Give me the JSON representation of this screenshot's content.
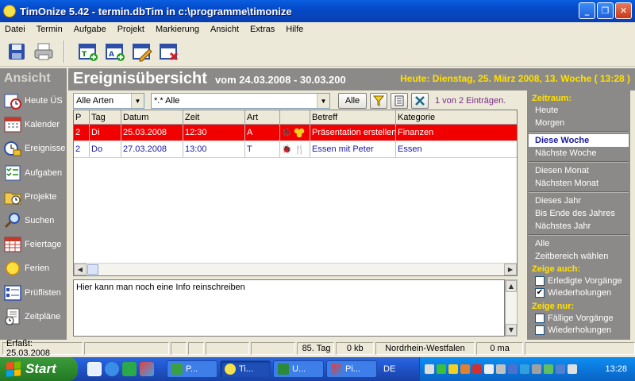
{
  "window": {
    "title": "TimOnize 5.42 - termin.dbTim in c:\\programme\\timonize"
  },
  "menu": [
    "Datei",
    "Termin",
    "Aufgabe",
    "Projekt",
    "Markierung",
    "Ansicht",
    "Extras",
    "Hilfe"
  ],
  "toolbar": {
    "icons": [
      "save-icon",
      "print-icon",
      "new-appointment-icon",
      "new-task-icon",
      "edit-icon",
      "delete-icon"
    ]
  },
  "nav": {
    "header": "Ansicht",
    "items": [
      {
        "label": "Heute ÜS",
        "icon": "clock-icon"
      },
      {
        "label": "Kalender",
        "icon": "calendar-icon"
      },
      {
        "label": "Ereignisse",
        "icon": "events-icon"
      },
      {
        "label": "Aufgaben",
        "icon": "tasks-icon"
      },
      {
        "label": "Projekte",
        "icon": "projects-icon"
      },
      {
        "label": "Suchen",
        "icon": "search-icon"
      },
      {
        "label": "Feiertage",
        "icon": "holidays-icon"
      },
      {
        "label": "Ferien",
        "icon": "sun-icon"
      },
      {
        "label": "Prüflisten",
        "icon": "checklist-icon"
      },
      {
        "label": "Zeitpläne",
        "icon": "schedule-icon"
      }
    ]
  },
  "main": {
    "title": "Ereignisübersicht",
    "range": "vom 24.03.2008 - 30.03.200",
    "today": "Heute: Dienstag, 25. März 2008, 13. Woche ( 13:28 )",
    "filter": {
      "types": "Alle Arten",
      "category": "*.* Alle",
      "all_button": "Alle",
      "count": "1 von 2 Einträgen."
    },
    "columns": [
      "P",
      "Tag",
      "Datum",
      "Zeit",
      "Art",
      "",
      "Betreff",
      "Kategorie"
    ],
    "rows": [
      {
        "p": "2",
        "tag": "Di",
        "datum": "25.03.2008",
        "zeit": "12:30",
        "art": "A",
        "betreff": "Präsentation erstellen",
        "kategorie": "Finanzen",
        "selected": true
      },
      {
        "p": "2",
        "tag": "Do",
        "datum": "27.03.2008",
        "zeit": "13:00",
        "art": "T",
        "betreff": "Essen mit  Peter",
        "kategorie": "Essen",
        "selected": false
      }
    ],
    "info": "Hier kann man noch eine Info reinschreiben"
  },
  "right": {
    "zeitraum_head": "Zeitraum:",
    "group1": [
      "Heute",
      "Morgen"
    ],
    "group2": [
      "Diese Woche",
      "Nächste Woche"
    ],
    "group3": [
      "Diesen Monat",
      "Nächsten Monat"
    ],
    "group4": [
      "Dieses Jahr",
      "Bis Ende des Jahres",
      "Nächstes Jahr"
    ],
    "group5": [
      "Alle",
      "Zeitbereich wählen"
    ],
    "zeige_auch_head": "Zeige auch:",
    "zeige_auch": [
      {
        "label": "Erledigte Vorgänge",
        "checked": false
      },
      {
        "label": "Wiederholungen",
        "checked": true
      }
    ],
    "zeige_nur_head": "Zeige nur:",
    "zeige_nur": [
      {
        "label": "Fällige Vorgänge",
        "checked": false
      },
      {
        "label": "Wiederholungen",
        "checked": false
      }
    ]
  },
  "status": {
    "erfasst": "Erfaßt: 25.03.2008",
    "tag": "85. Tag",
    "size": "0 kb",
    "region": "Nordrhein-Westfalen",
    "ma": "0 ma"
  },
  "taskbar": {
    "start": "Start",
    "tasks": [
      "P...",
      "Ti...",
      "U...",
      "Pi..."
    ],
    "lang": "DE",
    "clock": "13:28"
  },
  "colors": {
    "selected_row": "#f20000",
    "accent_yellow": "#ffe000",
    "panel_gray": "#8c8a88"
  }
}
